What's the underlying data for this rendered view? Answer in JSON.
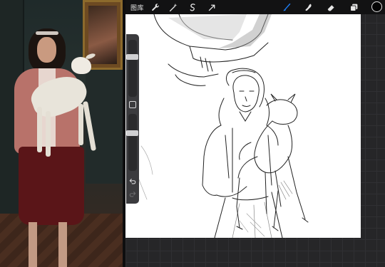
{
  "toolbar": {
    "gallery_label": "图库",
    "left_tools": [
      {
        "name": "wrench-icon"
      },
      {
        "name": "magic-wand-icon"
      },
      {
        "name": "selection-icon"
      },
      {
        "name": "transform-arrow-icon"
      }
    ],
    "right_tools": [
      {
        "name": "brush-icon",
        "active": true
      },
      {
        "name": "smudge-icon",
        "active": false
      },
      {
        "name": "eraser-icon",
        "active": false
      },
      {
        "name": "layers-icon",
        "active": false
      }
    ],
    "current_color": "#050505",
    "accent_color": "#1e7cf2"
  },
  "sidebar": {
    "brush_size": 0.72,
    "opacity": 0.68
  },
  "reference_photo": {
    "subject": "girl-holding-lamb"
  }
}
